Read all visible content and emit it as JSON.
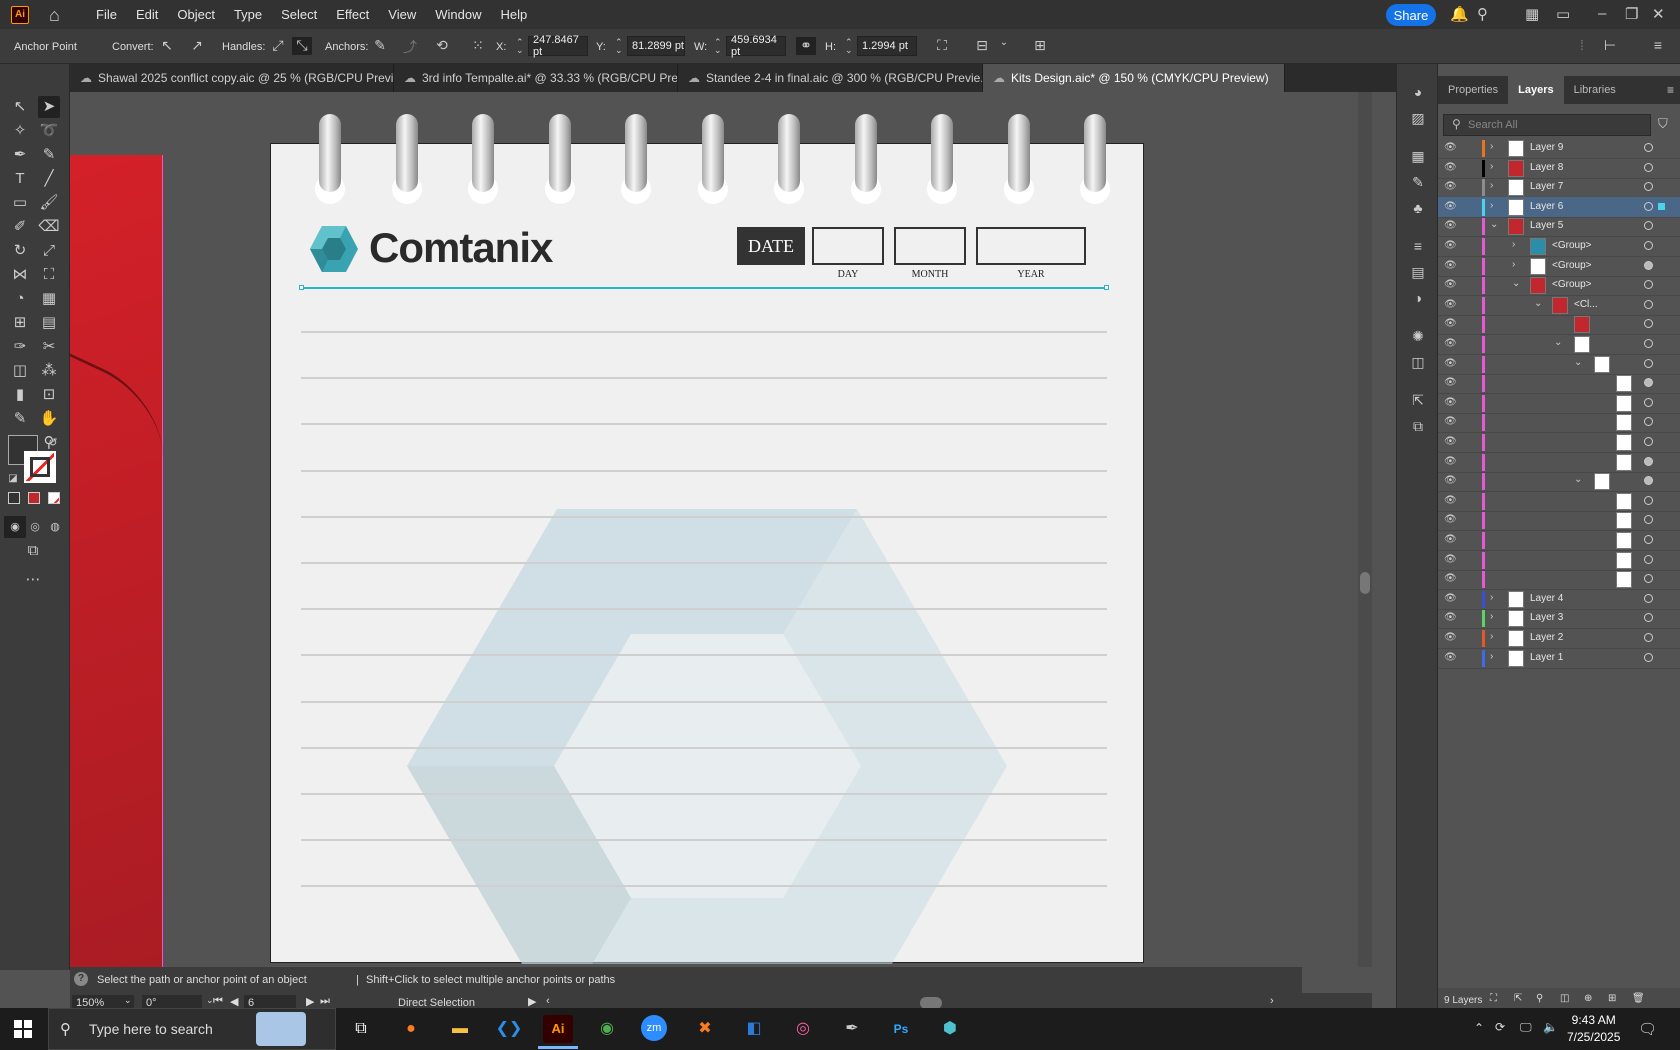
{
  "menubar": {
    "logo": "Ai",
    "items": [
      "File",
      "Edit",
      "Object",
      "Type",
      "Select",
      "Effect",
      "View",
      "Window",
      "Help"
    ],
    "share_label": "Share"
  },
  "control": {
    "tool_name": "Anchor Point",
    "convert_label": "Convert:",
    "handles_label": "Handles:",
    "anchors_label": "Anchors:",
    "x_label": "X:",
    "x_value": "247.8467 pt",
    "y_label": "Y:",
    "y_value": "81.2899 pt",
    "w_label": "W:",
    "w_value": "459.6934 pt",
    "h_label": "H:",
    "h_value": "1.2994 pt"
  },
  "tabs": [
    {
      "label": "Shawal 2025 conflict copy.aic @ 25 % (RGB/CPU Previ...",
      "active": false
    },
    {
      "label": "3rd info Tempalte.ai* @ 33.33 % (RGB/CPU Previe...",
      "active": false
    },
    {
      "label": "Standee 2-4 in final.aic @ 300 % (RGB/CPU Previe...",
      "active": false
    },
    {
      "label": "Kits Design.aic* @ 150 % (CMYK/CPU Preview)",
      "active": true
    }
  ],
  "artwork": {
    "brand": "Comtanix",
    "date_label": "DATE",
    "day_label": "DAY",
    "month_label": "MONTH",
    "year_label": "YEAR"
  },
  "status": {
    "hint": "Select the path or anchor point of an object",
    "hint2": "Shift+Click to select multiple anchor points or paths",
    "zoom": "150%",
    "rotation": "0°",
    "artboard": "6",
    "mode": "Direct Selection"
  },
  "panel": {
    "tabs": [
      "Properties",
      "Layers",
      "Libraries"
    ],
    "active_tab": "Layers",
    "search_placeholder": "Search All",
    "footer_count": "9 Layers",
    "layers": [
      {
        "name": "Layer 9",
        "color": "#e87423",
        "depth": 0,
        "chev": ">",
        "thumb": "#fff"
      },
      {
        "name": "Layer 8",
        "color": "#000000",
        "depth": 0,
        "chev": ">",
        "thumb": "#c1272d"
      },
      {
        "name": "Layer 7",
        "color": "#8c8c8c",
        "depth": 0,
        "chev": ">",
        "thumb": "#fff"
      },
      {
        "name": "Layer 6",
        "color": "#4cd2ea",
        "depth": 0,
        "chev": ">",
        "thumb": "#fff",
        "selected": true
      },
      {
        "name": "Layer 5",
        "color": "#e25ad6",
        "depth": 0,
        "chev": "v",
        "thumb": "#c1272d"
      },
      {
        "name": "<Group>",
        "color": "#e25ad6",
        "depth": 1,
        "chev": ">",
        "thumb": "#2a8ea8"
      },
      {
        "name": "<Group>",
        "color": "#e25ad6",
        "depth": 1,
        "chev": ">",
        "thumb": "#fff"
      },
      {
        "name": "<Group>",
        "color": "#e25ad6",
        "depth": 1,
        "chev": "v",
        "thumb": "#c1272d"
      },
      {
        "name": "<Cl...",
        "color": "#e25ad6",
        "depth": 2,
        "chev": "v",
        "thumb": "#c1272d"
      },
      {
        "name": "",
        "color": "#e25ad6",
        "depth": 3,
        "chev": "",
        "thumb": "#c1272d"
      },
      {
        "name": "",
        "color": "#e25ad6",
        "depth": 3,
        "chev": "v",
        "thumb": "#fff"
      },
      {
        "name": "",
        "color": "#e25ad6",
        "depth": 4,
        "chev": "v",
        "thumb": "#fff"
      },
      {
        "name": "",
        "color": "#e25ad6",
        "depth": 5,
        "chev": "",
        "thumb": "#fff"
      },
      {
        "name": "",
        "color": "#e25ad6",
        "depth": 5,
        "chev": "",
        "thumb": "#fff"
      },
      {
        "name": "",
        "color": "#e25ad6",
        "depth": 5,
        "chev": "",
        "thumb": "#fff"
      },
      {
        "name": "",
        "color": "#e25ad6",
        "depth": 5,
        "chev": "",
        "thumb": "#fff"
      },
      {
        "name": "",
        "color": "#e25ad6",
        "depth": 5,
        "chev": "",
        "thumb": "#fff"
      },
      {
        "name": "",
        "color": "#e25ad6",
        "depth": 4,
        "chev": "v",
        "thumb": "#fff"
      },
      {
        "name": "",
        "color": "#e25ad6",
        "depth": 5,
        "chev": "",
        "thumb": "#fff"
      },
      {
        "name": "",
        "color": "#e25ad6",
        "depth": 5,
        "chev": "",
        "thumb": "#fff"
      },
      {
        "name": "",
        "color": "#e25ad6",
        "depth": 5,
        "chev": "",
        "thumb": "#fff"
      },
      {
        "name": "",
        "color": "#e25ad6",
        "depth": 5,
        "chev": "",
        "thumb": "#fff"
      },
      {
        "name": "",
        "color": "#e25ad6",
        "depth": 5,
        "chev": "",
        "thumb": "#fff"
      },
      {
        "name": "Layer 4",
        "color": "#3a4ed8",
        "depth": 0,
        "chev": ">",
        "thumb": "#fff"
      },
      {
        "name": "Layer 3",
        "color": "#5fd35f",
        "depth": 0,
        "chev": ">",
        "thumb": "#fff"
      },
      {
        "name": "Layer 2",
        "color": "#e25a2a",
        "depth": 0,
        "chev": ">",
        "thumb": "#fff"
      },
      {
        "name": "Layer 1",
        "color": "#3a6ee8",
        "depth": 0,
        "chev": ">",
        "thumb": "#fff"
      }
    ]
  },
  "taskbar": {
    "search_placeholder": "Type here to search",
    "time": "9:43 AM",
    "date": "7/25/2025"
  },
  "colors": {
    "accent": "#1473e6",
    "brand_teal": "#2ab4c6",
    "artboard_red": "#d42029"
  }
}
